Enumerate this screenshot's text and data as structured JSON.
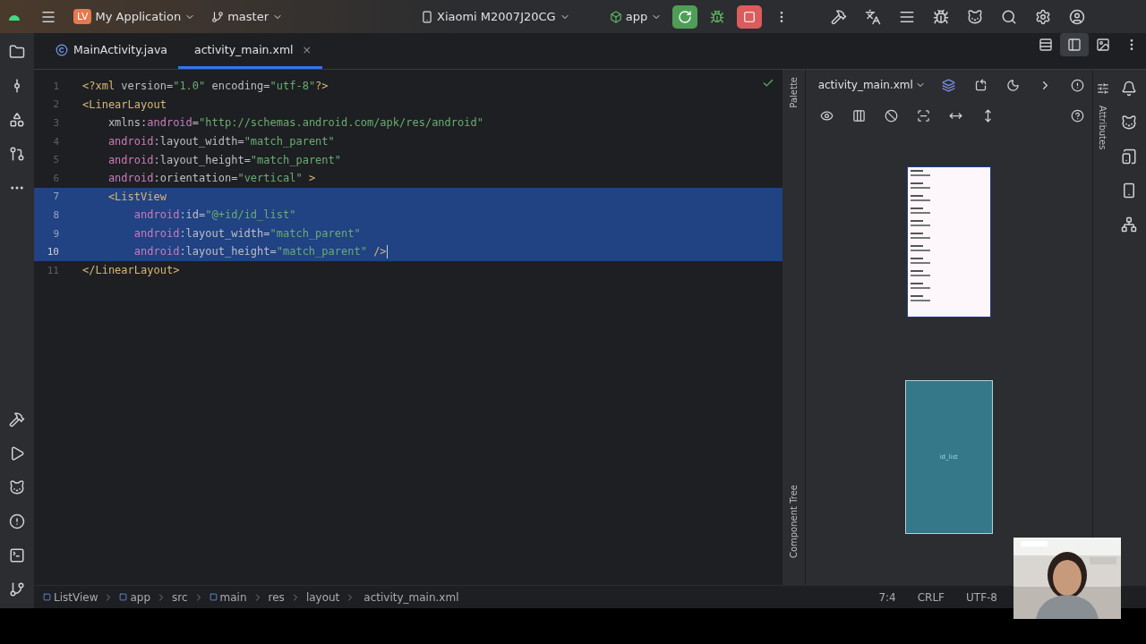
{
  "toolbar": {
    "project_badge": "LV",
    "project": "My Application",
    "branch": "master",
    "device": "Xiaomi M2007J20CG",
    "run_config": "app"
  },
  "tabs": [
    {
      "label": "MainActivity.java",
      "kind": "java",
      "selected": false
    },
    {
      "label": "activity_main.xml",
      "kind": "xml",
      "selected": true,
      "close": "×"
    }
  ],
  "code": {
    "lines": [
      {
        "number": "1",
        "selected": false,
        "current": false,
        "parts": [
          {
            "kind": "tag",
            "text": "<?xml "
          },
          {
            "kind": "plain",
            "text": "version="
          },
          {
            "kind": "value",
            "text": "\"1.0\""
          },
          {
            "kind": "plain",
            "text": " encoding="
          },
          {
            "kind": "value",
            "text": "\"utf-8\""
          },
          {
            "kind": "tag",
            "text": "?>"
          }
        ]
      },
      {
        "number": "2",
        "selected": false,
        "current": false,
        "parts": [
          {
            "kind": "tag",
            "text": "<LinearLayout"
          }
        ]
      },
      {
        "number": "3",
        "selected": false,
        "current": false,
        "parts": [
          {
            "kind": "plain",
            "text": "    xmlns:"
          },
          {
            "kind": "ns",
            "text": "android"
          },
          {
            "kind": "plain",
            "text": "="
          },
          {
            "kind": "value",
            "text": "\"http://schemas.android.com/apk/res/android\""
          }
        ]
      },
      {
        "number": "4",
        "selected": false,
        "current": false,
        "parts": [
          {
            "kind": "ns",
            "text": "    android"
          },
          {
            "kind": "plain",
            "text": ":layout_width="
          },
          {
            "kind": "value",
            "text": "\"match_parent\""
          }
        ]
      },
      {
        "number": "5",
        "selected": false,
        "current": false,
        "parts": [
          {
            "kind": "ns",
            "text": "    android"
          },
          {
            "kind": "plain",
            "text": ":layout_height="
          },
          {
            "kind": "value",
            "text": "\"match_parent\""
          }
        ]
      },
      {
        "number": "6",
        "selected": false,
        "current": false,
        "parts": [
          {
            "kind": "ns",
            "text": "    android"
          },
          {
            "kind": "plain",
            "text": ":orientation="
          },
          {
            "kind": "value",
            "text": "\"vertical\""
          },
          {
            "kind": "tag",
            "text": " >"
          }
        ]
      },
      {
        "number": "7",
        "selected": true,
        "current": false,
        "parts": [
          {
            "kind": "tag",
            "text": "    <ListView"
          }
        ]
      },
      {
        "number": "8",
        "selected": true,
        "current": false,
        "parts": [
          {
            "kind": "ns",
            "text": "        android"
          },
          {
            "kind": "plain",
            "text": ":id="
          },
          {
            "kind": "value",
            "text": "\"@+id/id_list\""
          }
        ]
      },
      {
        "number": "9",
        "selected": true,
        "current": false,
        "parts": [
          {
            "kind": "ns",
            "text": "        android"
          },
          {
            "kind": "plain",
            "text": ":layout_width="
          },
          {
            "kind": "value",
            "text": "\"match_parent\""
          }
        ]
      },
      {
        "number": "10",
        "selected": true,
        "current": true,
        "parts": [
          {
            "kind": "ns",
            "text": "        android"
          },
          {
            "kind": "plain",
            "text": ":layout_height="
          },
          {
            "kind": "value",
            "text": "\"match_parent\""
          },
          {
            "kind": "tag",
            "text": " />"
          }
        ]
      },
      {
        "number": "11",
        "selected": false,
        "current": false,
        "parts": [
          {
            "kind": "tag",
            "text": "</LinearLayout>"
          }
        ]
      }
    ]
  },
  "design": {
    "file": "activity_main.xml",
    "palette": "Palette",
    "component_tree": "Component Tree",
    "attributes": "Attributes",
    "blueprint_label": "id_list"
  },
  "breadcrumbs": [
    {
      "label": "ListView",
      "kind": "component"
    },
    {
      "label": "app",
      "kind": "module"
    },
    {
      "label": "src",
      "kind": "folder"
    },
    {
      "label": "main",
      "kind": "module"
    },
    {
      "label": "res",
      "kind": "folder"
    },
    {
      "label": "layout",
      "kind": "folder"
    },
    {
      "label": "activity_main.xml",
      "kind": "xml"
    }
  ],
  "status": {
    "position": "7:4",
    "line_separator": "CRLF",
    "encoding": "UTF-8"
  }
}
